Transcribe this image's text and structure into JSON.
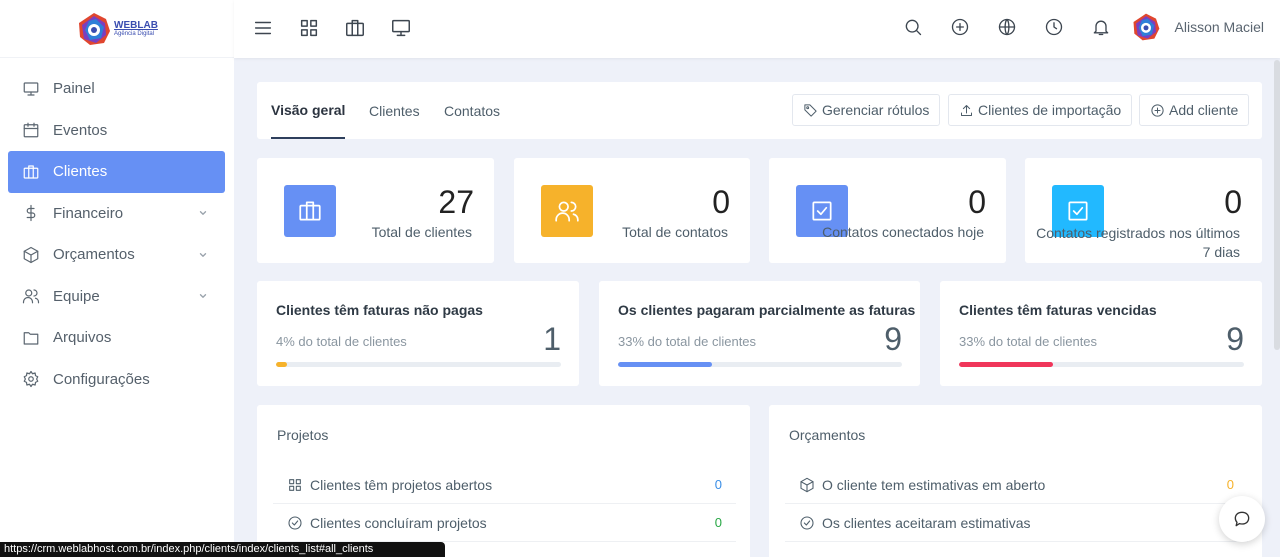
{
  "brand": {
    "name": "WEBLAB",
    "tagline": "Agência Digital"
  },
  "sidebar": {
    "items": [
      {
        "label": "Painel",
        "icon": "monitor-icon"
      },
      {
        "label": "Eventos",
        "icon": "calendar-icon"
      },
      {
        "label": "Clientes",
        "icon": "briefcase-icon",
        "active": true
      },
      {
        "label": "Financeiro",
        "icon": "dollar-icon",
        "expandable": true
      },
      {
        "label": "Orçamentos",
        "icon": "box-icon",
        "expandable": true
      },
      {
        "label": "Equipe",
        "icon": "users-icon",
        "expandable": true
      },
      {
        "label": "Arquivos",
        "icon": "folder-icon"
      },
      {
        "label": "Configurações",
        "icon": "settings-icon"
      }
    ]
  },
  "topbar": {
    "user_name": "Alisson Maciel"
  },
  "tabs": {
    "items": [
      "Visão geral",
      "Clientes",
      "Contatos"
    ],
    "buttons": {
      "labels": "Gerenciar rótulos",
      "import": "Clientes de importação",
      "add": "Add cliente"
    }
  },
  "stats": [
    {
      "value": "27",
      "label": "Total de clientes",
      "color": "#6690f4"
    },
    {
      "value": "0",
      "label": "Total de contatos",
      "color": "#f6b22b"
    },
    {
      "value": "0",
      "label": "Contatos conectados hoje",
      "color": "#6690f4"
    },
    {
      "value": "0",
      "label": "Contatos registrados nos últimos 7 dias",
      "color": "#22b9ff"
    }
  ],
  "invoices": [
    {
      "title": "Clientes têm faturas não pagas",
      "sub": "4% do total de clientes",
      "value": "1",
      "progress": 0.04,
      "color": "#f6b22b"
    },
    {
      "title": "Os clientes pagaram parcialmente as faturas",
      "sub": "33% do total de clientes",
      "value": "9",
      "progress": 0.33,
      "color": "#6690f4"
    },
    {
      "title": "Clientes têm faturas vencidas",
      "sub": "33% do total de clientes",
      "value": "9",
      "progress": 0.33,
      "color": "#f0365a"
    }
  ],
  "projects": {
    "title": "Projetos",
    "rows": [
      {
        "label": "Clientes têm projetos abertos",
        "count": "0",
        "count_color": "#3a8ee6"
      },
      {
        "label": "Clientes concluíram projetos",
        "count": "0",
        "count_color": "#28a745"
      }
    ]
  },
  "estimates": {
    "title": "Orçamentos",
    "rows": [
      {
        "label": "O cliente tem estimativas em aberto",
        "count": "0",
        "count_color": "#f6b22b"
      },
      {
        "label": "Os clientes aceitaram estimativas",
        "count": "",
        "count_color": "#28a745"
      }
    ]
  },
  "statusbar": {
    "url": "https://crm.weblabhost.com.br/index.php/clients/index/clients_list#all_clients"
  }
}
